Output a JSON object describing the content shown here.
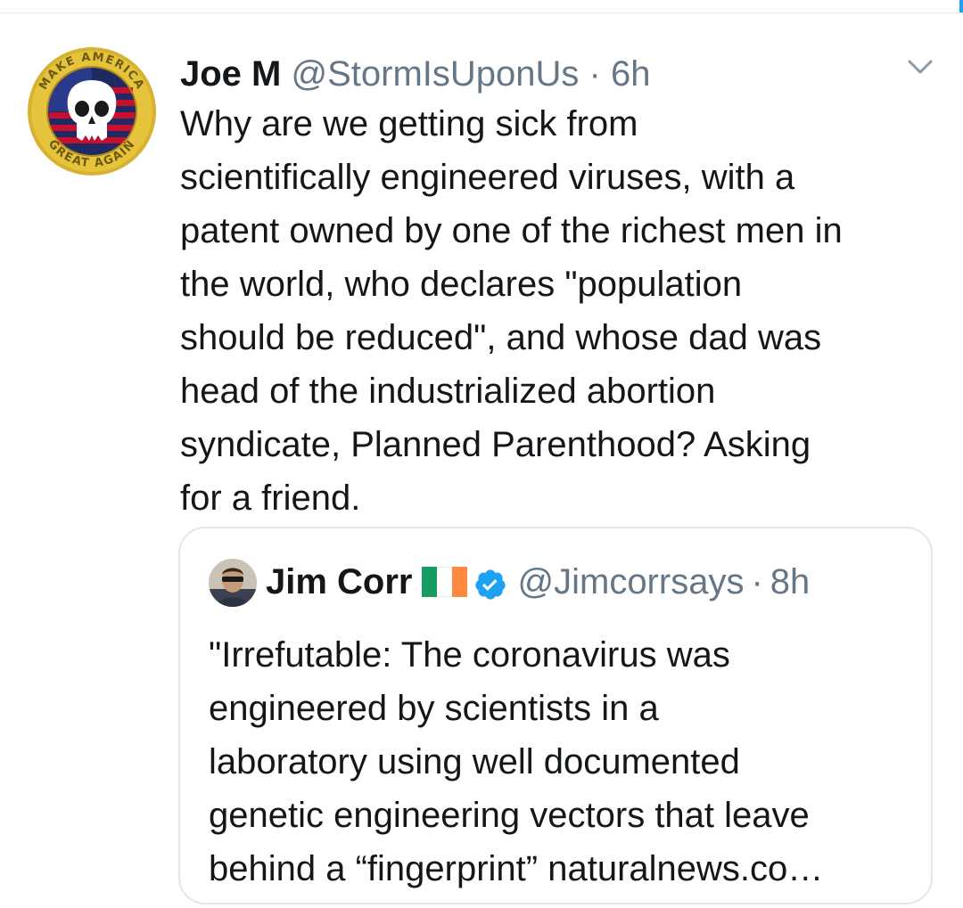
{
  "tweet": {
    "author_name": "Joe M",
    "handle": "@StormIsUponUs",
    "separator": "·",
    "time": "6h",
    "avatar_badge_text": "MAKE AMERICA GREAT AGAIN",
    "body_lines": [
      "Why are we getting sick from",
      "scientifically engineered viruses, with a",
      "patent owned by one of the richest men in",
      "the world, who declares \"population",
      "should be reduced\", and whose dad was",
      "head of the industrialized abortion",
      "syndicate, Planned Parenthood? Asking",
      "for a friend."
    ]
  },
  "quoted": {
    "author_name": "Jim Corr",
    "handle": "@Jimcorrsays",
    "separator": "·",
    "time": "8h",
    "flag_colors": [
      "#169b62",
      "#ffffff",
      "#ff883e"
    ],
    "verified_color": "#1da1f2",
    "body_lines": [
      "\"Irrefutable: The coronavirus was",
      "engineered by scientists in a",
      "laboratory using well documented",
      "genetic engineering vectors that leave",
      "behind a “fingerprint” naturalnews.co…"
    ]
  },
  "icons": {
    "more": "chevron-down-icon",
    "verified": "verified-badge-icon",
    "flag": "ireland-flag-icon"
  },
  "colors": {
    "text": "#14171a",
    "secondary": "#657786",
    "border": "#e1e8ed",
    "accent": "#1da1f2"
  }
}
